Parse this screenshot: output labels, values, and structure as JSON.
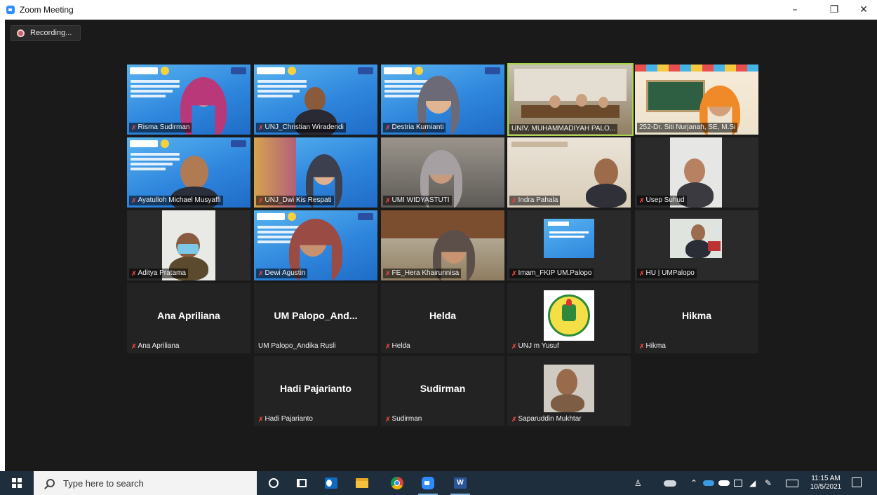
{
  "window": {
    "title": "Zoom Meeting",
    "minimize": "–",
    "maximize": "❐",
    "close": "✕"
  },
  "recording": {
    "label": "Recording..."
  },
  "participants": [
    {
      "name": "Risma Sudirman",
      "muted": true,
      "video": "banner"
    },
    {
      "name": "UNJ_Christian Wiradendi",
      "muted": true,
      "video": "banner"
    },
    {
      "name": "Destria Kurnianti",
      "muted": true,
      "video": "banner"
    },
    {
      "name": "UNIV. MUHAMMADIYAH PALO...",
      "muted": false,
      "video": "room",
      "active_speaker": true
    },
    {
      "name": "252-Dr. Siti Nurjanah, SE, M.Si",
      "muted": false,
      "video": "class"
    },
    {
      "name": "Ayatulloh Michael Musyaffi",
      "muted": true,
      "video": "banner"
    },
    {
      "name": "UNJ_Dwi Kis Respati",
      "muted": true,
      "video": "banner"
    },
    {
      "name": "UMI WIDYASTUTI",
      "muted": true,
      "video": "grey"
    },
    {
      "name": "Indra Pahala",
      "muted": true,
      "video": "office"
    },
    {
      "name": "Usep Suhud",
      "muted": true,
      "video": "portrait"
    },
    {
      "name": "Aditya Pratama",
      "muted": true,
      "video": "portrait"
    },
    {
      "name": "Dewi Agustin",
      "muted": true,
      "video": "banner"
    },
    {
      "name": "FE_Hera Khairunnisa",
      "muted": true,
      "video": "room"
    },
    {
      "name": "Imam_FKIP UM.Palopo",
      "muted": true,
      "video": "poster"
    },
    {
      "name": "HU | UMPalopo",
      "muted": true,
      "video": "portrait"
    },
    {
      "name": "Ana Apriliana",
      "muted": true,
      "video": "off",
      "display": "Ana Apriliana"
    },
    {
      "name": "UM Palopo_Andika Rusli",
      "muted": false,
      "video": "off",
      "display": "UM  Palopo_And..."
    },
    {
      "name": "Helda",
      "muted": true,
      "video": "off",
      "display": "Helda"
    },
    {
      "name": "UNJ m Yusuf",
      "muted": true,
      "video": "logo"
    },
    {
      "name": "Hikma",
      "muted": true,
      "video": "off",
      "display": "Hikma"
    },
    {
      "name": "Hadi Pajarianto",
      "muted": true,
      "video": "off",
      "display": "Hadi Pajarianto"
    },
    {
      "name": "Sudirman",
      "muted": true,
      "video": "off",
      "display": "Sudirman"
    },
    {
      "name": "Saparuddin Mukhtar",
      "muted": true,
      "video": "portrait"
    }
  ],
  "taskbar": {
    "search_placeholder": "Type here to search",
    "time": "11:15 AM",
    "date": "10/5/2021"
  },
  "icons": {
    "app": "zoom-icon",
    "mic_muted": "mic-muted-icon",
    "start": "windows-start-icon",
    "search": "search-icon",
    "cortana": "cortana-icon",
    "task_view": "task-view-icon",
    "outlook": "outlook-icon",
    "explorer": "file-explorer-icon",
    "chrome": "chrome-icon",
    "zoom": "zoom-taskbar-icon",
    "word": "word-icon"
  }
}
